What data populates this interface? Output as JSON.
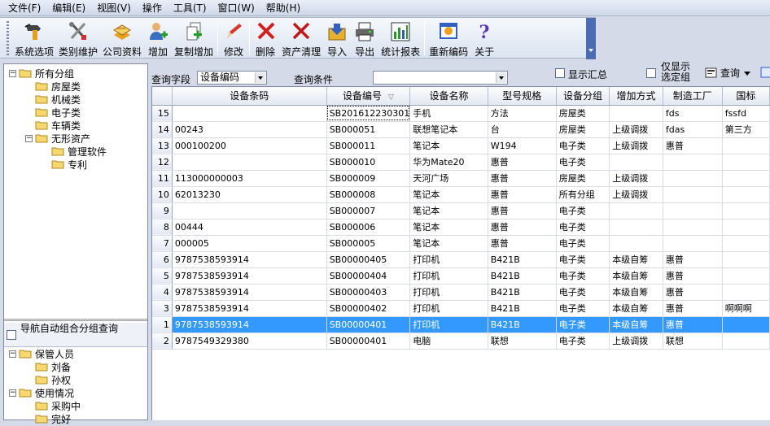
{
  "menu": [
    "文件(F)",
    "编辑(E)",
    "视图(V)",
    "操作",
    "工具(T)",
    "窗口(W)",
    "帮助(H)"
  ],
  "toolbar": [
    {
      "label": "系统选项",
      "icon": "system-options-icon"
    },
    {
      "label": "类别维护",
      "icon": "category-tools-icon"
    },
    {
      "label": "公司资料",
      "icon": "company-info-icon"
    },
    {
      "label": "增加",
      "icon": "add-icon"
    },
    {
      "label": "复制增加",
      "icon": "copy-add-icon"
    },
    {
      "label": "修改",
      "icon": "edit-pen-icon"
    },
    {
      "label": "删除",
      "icon": "delete-x-icon"
    },
    {
      "label": "资产清理",
      "icon": "asset-clear-x-icon"
    },
    {
      "label": "导入",
      "icon": "import-icon"
    },
    {
      "label": "导出",
      "icon": "export-printer-icon"
    },
    {
      "label": "统计报表",
      "icon": "statistics-chart-icon"
    },
    {
      "label": "重新编码",
      "icon": "recode-icon"
    },
    {
      "label": "关于",
      "icon": "about-question-icon"
    }
  ],
  "tree": [
    {
      "label": "所有分组",
      "level": 0,
      "expand": "−"
    },
    {
      "label": "房屋类",
      "level": 1,
      "expand": ""
    },
    {
      "label": "机械类",
      "level": 1,
      "expand": ""
    },
    {
      "label": "电子类",
      "level": 1,
      "expand": ""
    },
    {
      "label": "车辆类",
      "level": 1,
      "expand": ""
    },
    {
      "label": "无形资产",
      "level": 1,
      "expand": "−"
    },
    {
      "label": "管理软件",
      "level": 2,
      "expand": ""
    },
    {
      "label": "专利",
      "level": 2,
      "expand": ""
    }
  ],
  "auto_group_label": "导航自动组合分组查询",
  "tree2": [
    {
      "label": "保管人员",
      "level": 0,
      "expand": "−"
    },
    {
      "label": "刘备",
      "level": 1,
      "expand": ""
    },
    {
      "label": "孙权",
      "level": 1,
      "expand": ""
    },
    {
      "label": "使用情况",
      "level": 0,
      "expand": "−"
    },
    {
      "label": "采购中",
      "level": 1,
      "expand": ""
    },
    {
      "label": "完好",
      "level": 1,
      "expand": ""
    }
  ],
  "query": {
    "field_label": "查询字段",
    "field_value": "设备编码",
    "cond_label": "查询条件",
    "cond_value": "",
    "show_summary": "显示汇总",
    "only_show_1": "仅显示",
    "only_show_2": "选定组",
    "query_button": "查询"
  },
  "columns": [
    "设备条码",
    "设备编号",
    "设备名称",
    "型号规格",
    "设备分组",
    "增加方式",
    "制造工厂",
    "国标"
  ],
  "rows": [
    {
      "n": "15",
      "c": [
        "",
        "SB201612230301",
        "手机",
        "方法",
        "房屋类",
        "",
        "fds",
        "fssfd"
      ]
    },
    {
      "n": "14",
      "c": [
        "00243",
        "SB000051",
        "联想笔记本",
        "台",
        "房屋类",
        "上级调拨",
        "fdas",
        "第三方"
      ]
    },
    {
      "n": "13",
      "c": [
        "000100200",
        "SB000011",
        "笔记本",
        "W194",
        "电子类",
        "上级调拨",
        "惠普",
        ""
      ]
    },
    {
      "n": "12",
      "c": [
        "",
        "SB000010",
        "华为Mate20",
        "惠普",
        "电子类",
        "",
        "",
        ""
      ]
    },
    {
      "n": "11",
      "c": [
        "113000000003",
        "SB000009",
        "天河广场",
        "惠普",
        "房屋类",
        "上级调拨",
        "",
        ""
      ]
    },
    {
      "n": "10",
      "c": [
        "62013230",
        "SB000008",
        "笔记本",
        "惠普",
        "所有分组",
        "上级调拨",
        "",
        ""
      ]
    },
    {
      "n": "9",
      "c": [
        "",
        "SB000007",
        "笔记本",
        "惠普",
        "电子类",
        "",
        "",
        ""
      ]
    },
    {
      "n": "8",
      "c": [
        "00444",
        "SB000006",
        "笔记本",
        "惠普",
        "电子类",
        "",
        "",
        ""
      ]
    },
    {
      "n": "7",
      "c": [
        "000005",
        "SB000005",
        "笔记本",
        "惠普",
        "电子类",
        "",
        "",
        ""
      ]
    },
    {
      "n": "6",
      "c": [
        "9787538593914",
        "SB00000405",
        "打印机",
        "B421B",
        "电子类",
        "本级自筹",
        "惠普",
        ""
      ]
    },
    {
      "n": "5",
      "c": [
        "9787538593914",
        "SB00000404",
        "打印机",
        "B421B",
        "电子类",
        "本级自筹",
        "惠普",
        ""
      ]
    },
    {
      "n": "4",
      "c": [
        "9787538593914",
        "SB00000403",
        "打印机",
        "B421B",
        "电子类",
        "本级自筹",
        "惠普",
        ""
      ]
    },
    {
      "n": "3",
      "c": [
        "9787538593914",
        "SB00000402",
        "打印机",
        "B421B",
        "电子类",
        "本级自筹",
        "惠普",
        "啊啊啊"
      ]
    },
    {
      "n": "1",
      "c": [
        "9787538593914",
        "SB00000401",
        "打印机",
        "B421B",
        "电子类",
        "本级自筹",
        "惠普",
        ""
      ]
    },
    {
      "n": "2",
      "c": [
        "9787549329380",
        "SB00000401",
        "电脑",
        "联想",
        "电子类",
        "上级调拨",
        "联想",
        ""
      ]
    }
  ],
  "selected_row": "1"
}
